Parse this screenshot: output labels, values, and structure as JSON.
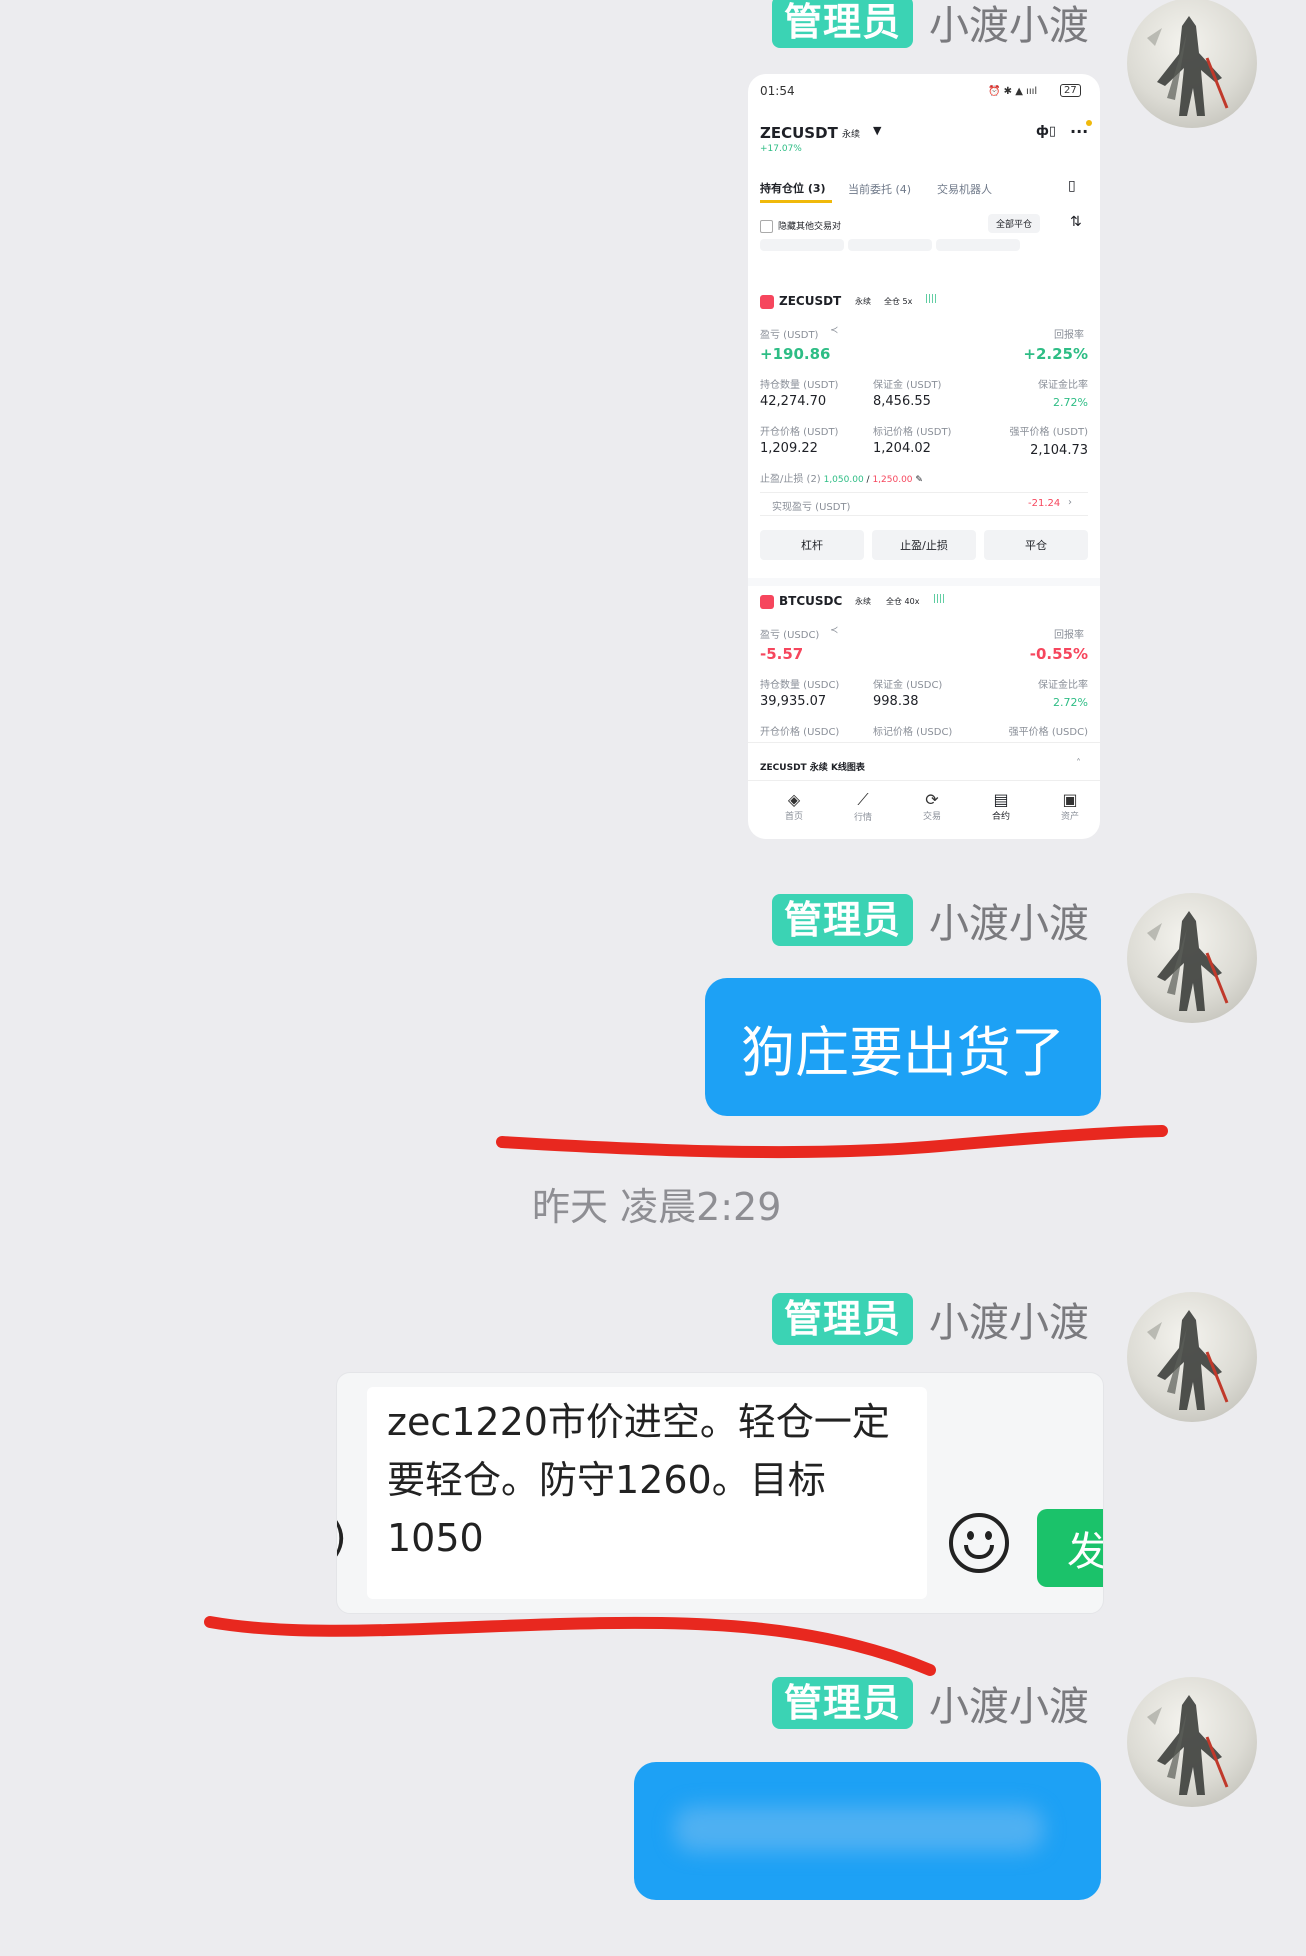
{
  "sender": {
    "badge": "管理员",
    "name": "小渡小渡"
  },
  "messages": [
    {
      "type": "image"
    },
    {
      "type": "text",
      "text": "狗庄要出货了"
    },
    {
      "type": "text-input",
      "text": "zec1220市价进空。轻仓一定要轻仓。防守1260。目标1050",
      "send_label": "发"
    },
    {
      "type": "text-blurred"
    }
  ],
  "timestamp": "昨天 凌晨2:29",
  "colors": {
    "badge": "#3bd3b4",
    "bubble": "#1da1f5",
    "highlight_line": "#e8281f",
    "send_button": "#1bc26a"
  },
  "phone": {
    "time": "01:54",
    "battery": "27",
    "pair": "ZECUSDT",
    "pair_suffix": "永续",
    "change": "+17.07%",
    "tabs": [
      "持有仓位 (3)",
      "当前委托 (4)",
      "交易机器人"
    ],
    "hide_other": "隐藏其他交易对",
    "close_all": "全部平仓",
    "positions": [
      {
        "symbol": "ZECUSDT",
        "tag": "永续",
        "mode": "全仓 5x",
        "pnl_label": "盈亏 (USDT)",
        "pnl": "+190.86",
        "roe_label": "回报率",
        "roe": "+2.25%",
        "size_label": "持仓数量 (USDT)",
        "size": "42,274.70",
        "margin_label": "保证金 (USDT)",
        "margin": "8,456.55",
        "margin_ratio_label": "保证金比率",
        "margin_ratio": "2.72%",
        "entry_label": "开仓价格 (USDT)",
        "entry": "1,209.22",
        "mark_label": "标记价格 (USDT)",
        "mark": "1,204.02",
        "liq_label": "强平价格 (USDT)",
        "liq": "2,104.73",
        "tpsl_label": "止盈/止损 (2)",
        "tp": "1,050.00",
        "sl": "1,250.00",
        "realized_label": "实现盈亏 (USDT)",
        "realized": "-21.24",
        "buttons": [
          "杠杆",
          "止盈/止损",
          "平仓"
        ]
      },
      {
        "symbol": "BTCUSDC",
        "tag": "永续",
        "mode": "全仓 40x",
        "pnl_label": "盈亏 (USDC)",
        "pnl": "-5.57",
        "roe_label": "回报率",
        "roe": "-0.55%",
        "size_label": "持仓数量 (USDC)",
        "size": "39,935.07",
        "margin_label": "保证金 (USDC)",
        "margin": "998.38",
        "margin_ratio_label": "保证金比率",
        "margin_ratio": "2.72%",
        "entry_label": "开仓价格 (USDC)",
        "mark_label": "标记价格 (USDC)",
        "liq_label": "强平价格 (USDC)"
      }
    ],
    "kline_bar": "ZECUSDT 永续 K线图表",
    "nav": [
      "首页",
      "行情",
      "交易",
      "合约",
      "资产"
    ]
  }
}
